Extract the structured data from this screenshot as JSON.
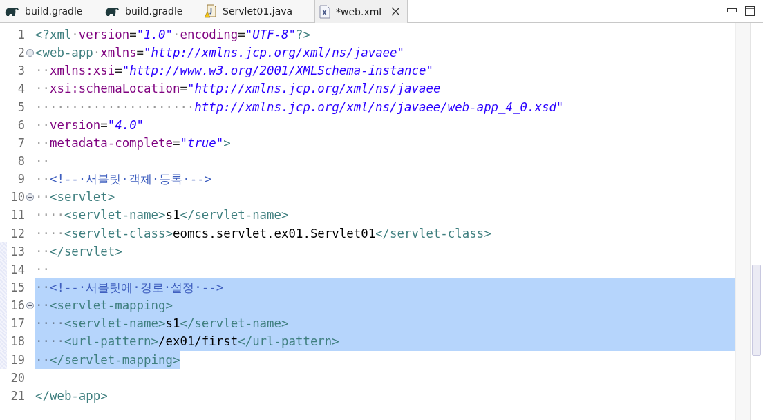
{
  "tabs": [
    {
      "label": "build.gradle",
      "kind": "gradle",
      "selected": false
    },
    {
      "label": "build.gradle",
      "kind": "gradle",
      "selected": false
    },
    {
      "label": "Servlet01.java",
      "kind": "java",
      "selected": false
    },
    {
      "label": "*web.xml",
      "kind": "xml",
      "selected": true
    }
  ],
  "lines": [
    {
      "number": "1",
      "fold": false,
      "changed": false,
      "selected": false,
      "tokens": [
        {
          "kind": "tag",
          "text": "<?xml"
        },
        {
          "kind": "ws",
          "text": "·"
        },
        {
          "kind": "attr",
          "text": "version"
        },
        {
          "kind": "punct",
          "text": "="
        },
        {
          "kind": "value",
          "text": "\"1.0\""
        },
        {
          "kind": "ws",
          "text": "·"
        },
        {
          "kind": "attr",
          "text": "encoding"
        },
        {
          "kind": "punct",
          "text": "="
        },
        {
          "kind": "value",
          "text": "\"UTF-8\""
        },
        {
          "kind": "tag",
          "text": "?>"
        }
      ]
    },
    {
      "number": "2",
      "fold": true,
      "changed": false,
      "selected": false,
      "tokens": [
        {
          "kind": "tag",
          "text": "<web-app"
        },
        {
          "kind": "ws",
          "text": "·"
        },
        {
          "kind": "attr",
          "text": "xmlns"
        },
        {
          "kind": "punct",
          "text": "="
        },
        {
          "kind": "value",
          "text": "\"http://xmlns.jcp.org/xml/ns/javaee\""
        }
      ]
    },
    {
      "number": "3",
      "fold": false,
      "changed": false,
      "selected": false,
      "tokens": [
        {
          "kind": "ws",
          "text": "··"
        },
        {
          "kind": "attr",
          "text": "xmlns:xsi"
        },
        {
          "kind": "punct",
          "text": "="
        },
        {
          "kind": "value",
          "text": "\"http://www.w3.org/2001/XMLSchema-instance\""
        }
      ]
    },
    {
      "number": "4",
      "fold": false,
      "changed": false,
      "selected": false,
      "tokens": [
        {
          "kind": "ws",
          "text": "··"
        },
        {
          "kind": "attr",
          "text": "xsi:schemaLocation"
        },
        {
          "kind": "punct",
          "text": "="
        },
        {
          "kind": "value",
          "text": "\"http://xmlns.jcp.org/xml/ns/javaee"
        }
      ]
    },
    {
      "number": "5",
      "fold": false,
      "changed": false,
      "selected": false,
      "tokens": [
        {
          "kind": "ws",
          "text": "······················"
        },
        {
          "kind": "value",
          "text": "http://xmlns.jcp.org/xml/ns/javaee/web-app_4_0.xsd\""
        }
      ]
    },
    {
      "number": "6",
      "fold": false,
      "changed": false,
      "selected": false,
      "tokens": [
        {
          "kind": "ws",
          "text": "··"
        },
        {
          "kind": "attr",
          "text": "version"
        },
        {
          "kind": "punct",
          "text": "="
        },
        {
          "kind": "value",
          "text": "\"4.0\""
        }
      ]
    },
    {
      "number": "7",
      "fold": false,
      "changed": false,
      "selected": false,
      "tokens": [
        {
          "kind": "ws",
          "text": "··"
        },
        {
          "kind": "attr",
          "text": "metadata-complete"
        },
        {
          "kind": "punct",
          "text": "="
        },
        {
          "kind": "value",
          "text": "\"true\""
        },
        {
          "kind": "tag",
          "text": ">"
        }
      ]
    },
    {
      "number": "8",
      "fold": false,
      "changed": false,
      "selected": false,
      "tokens": [
        {
          "kind": "ws",
          "text": "··"
        }
      ]
    },
    {
      "number": "9",
      "fold": false,
      "changed": false,
      "selected": false,
      "tokens": [
        {
          "kind": "ws",
          "text": "··"
        },
        {
          "kind": "comment",
          "text": "<!--·서블릿·객체·등록·-->"
        }
      ]
    },
    {
      "number": "10",
      "fold": true,
      "changed": false,
      "selected": false,
      "tokens": [
        {
          "kind": "ws",
          "text": "··"
        },
        {
          "kind": "tag",
          "text": "<servlet>"
        }
      ]
    },
    {
      "number": "11",
      "fold": false,
      "changed": false,
      "selected": false,
      "tokens": [
        {
          "kind": "ws",
          "text": "····"
        },
        {
          "kind": "tag",
          "text": "<servlet-name>"
        },
        {
          "kind": "text",
          "text": "s1"
        },
        {
          "kind": "tag",
          "text": "</servlet-name>"
        }
      ]
    },
    {
      "number": "12",
      "fold": false,
      "changed": false,
      "selected": false,
      "tokens": [
        {
          "kind": "ws",
          "text": "····"
        },
        {
          "kind": "tag",
          "text": "<servlet-class>"
        },
        {
          "kind": "text",
          "text": "eomcs.servlet.ex01.Servlet01"
        },
        {
          "kind": "tag",
          "text": "</servlet-class>"
        }
      ]
    },
    {
      "number": "13",
      "fold": false,
      "changed": true,
      "selected": false,
      "tokens": [
        {
          "kind": "ws",
          "text": "··"
        },
        {
          "kind": "tag",
          "text": "</servlet>"
        }
      ]
    },
    {
      "number": "14",
      "fold": false,
      "changed": true,
      "selected": false,
      "tokens": [
        {
          "kind": "ws",
          "text": "··"
        }
      ]
    },
    {
      "number": "15",
      "fold": false,
      "changed": true,
      "selected": true,
      "tokens": [
        {
          "kind": "ws",
          "text": "··"
        },
        {
          "kind": "comment",
          "text": "<!--·서블릿에·경로·설정·-->"
        }
      ]
    },
    {
      "number": "16",
      "fold": true,
      "changed": true,
      "selected": true,
      "tokens": [
        {
          "kind": "ws",
          "text": "··"
        },
        {
          "kind": "tag",
          "text": "<servlet-mapping>"
        }
      ]
    },
    {
      "number": "17",
      "fold": false,
      "changed": true,
      "selected": true,
      "tokens": [
        {
          "kind": "ws",
          "text": "····"
        },
        {
          "kind": "tag",
          "text": "<servlet-name>"
        },
        {
          "kind": "text",
          "text": "s1"
        },
        {
          "kind": "tag",
          "text": "</servlet-name>"
        }
      ]
    },
    {
      "number": "18",
      "fold": false,
      "changed": true,
      "selected": true,
      "tokens": [
        {
          "kind": "ws",
          "text": "····"
        },
        {
          "kind": "tag",
          "text": "<url-pattern>"
        },
        {
          "kind": "text",
          "text": "/ex01/first"
        },
        {
          "kind": "tag",
          "text": "</url-pattern>"
        }
      ]
    },
    {
      "number": "19",
      "fold": false,
      "changed": true,
      "selected": true,
      "tokens": [
        {
          "kind": "ws",
          "text": "··"
        },
        {
          "kind": "tag",
          "text": "</servlet-mapping>"
        }
      ]
    },
    {
      "number": "20",
      "fold": false,
      "changed": false,
      "selected": false
    },
    {
      "number": "21",
      "fold": false,
      "changed": false,
      "selected": false,
      "tokens": [
        {
          "kind": "tag",
          "text": "</web-app>"
        }
      ]
    }
  ]
}
